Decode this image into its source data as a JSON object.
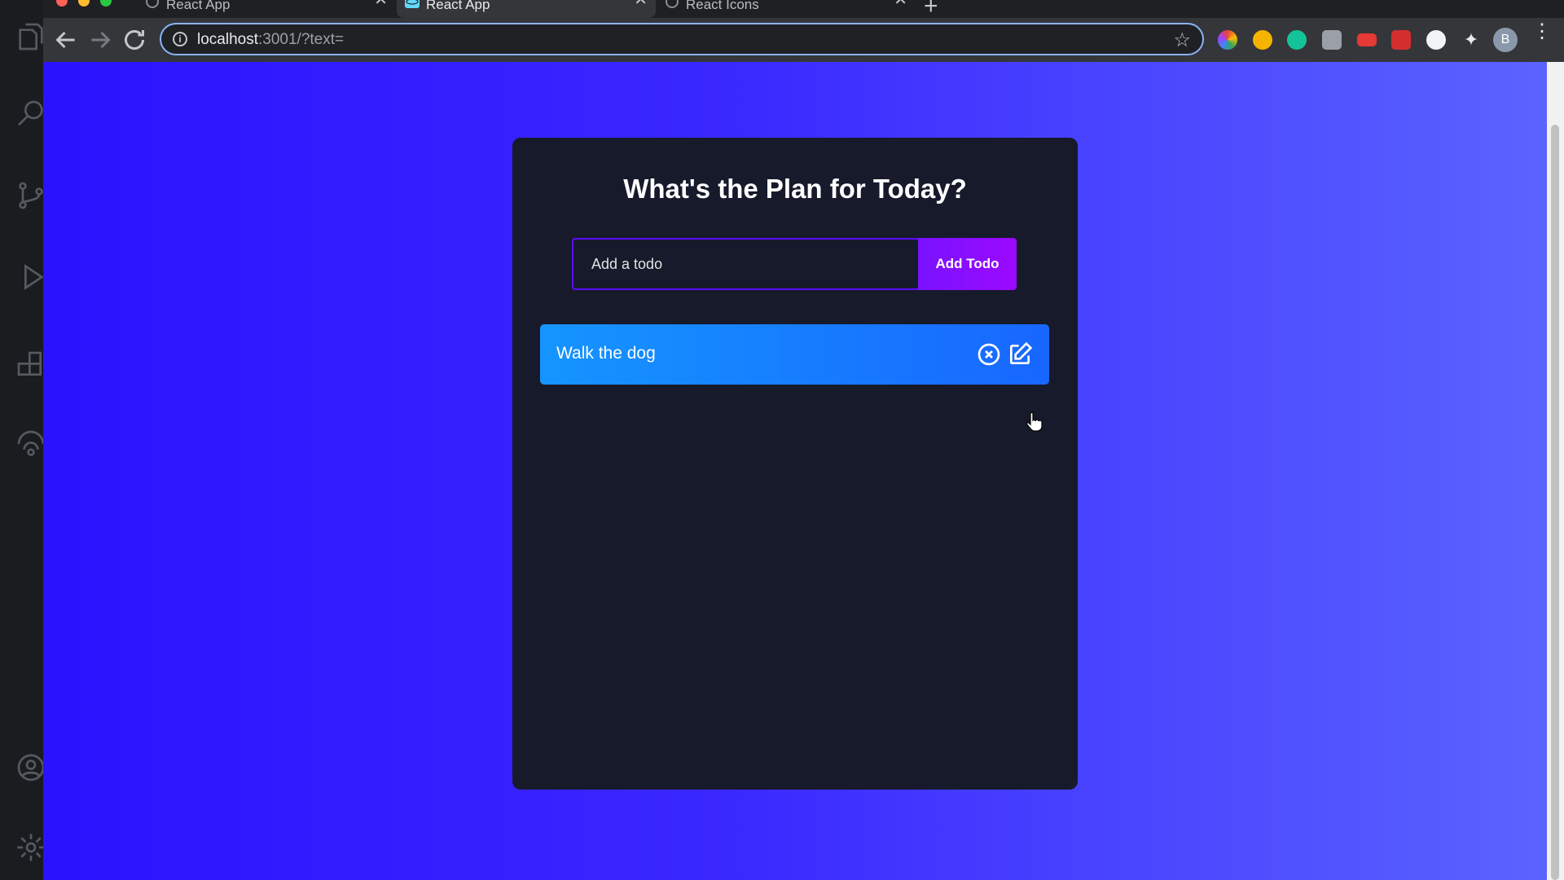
{
  "browser": {
    "tabs": [
      {
        "label": "React App",
        "active": false
      },
      {
        "label": "React App",
        "active": true
      },
      {
        "label": "React Icons",
        "active": false
      }
    ],
    "url": {
      "host": "localhost",
      "path": ":3001/?text="
    }
  },
  "app": {
    "title": "What's the Plan for Today?",
    "input_placeholder": "Add a todo",
    "add_button_label": "Add Todo",
    "todos": [
      {
        "text": "Walk the dog"
      }
    ]
  },
  "colors": {
    "background_gradient": [
      "#2b12ff",
      "#5a63ff"
    ],
    "card": "#161a2b",
    "input_border": "#5d0cff",
    "button_gradient": [
      "#7a12ff",
      "#9b09ff"
    ],
    "todo_row_gradient": [
      "#1595ff",
      "#1867ff"
    ]
  },
  "avatar_letter": "B"
}
